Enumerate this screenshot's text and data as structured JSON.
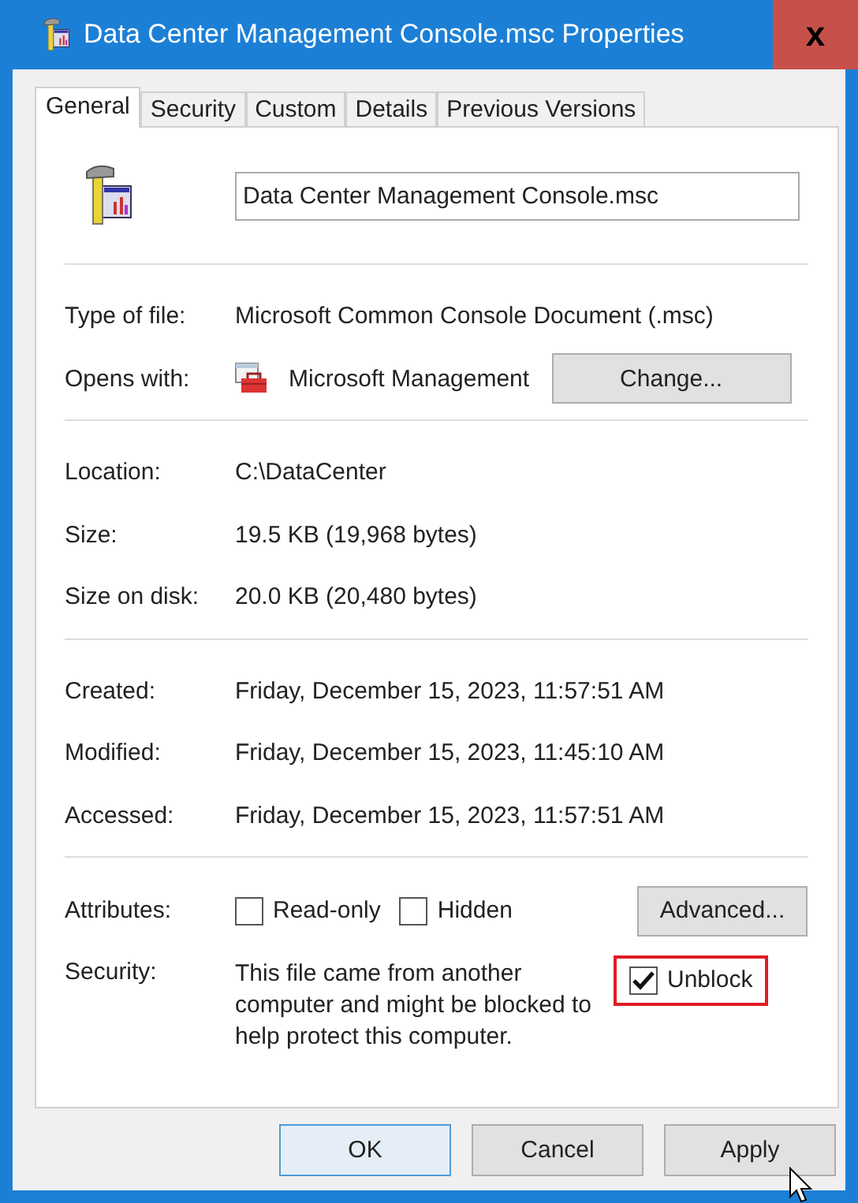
{
  "window": {
    "title": "Data Center Management Console.msc Properties",
    "close": "x"
  },
  "tabs": [
    {
      "label": "General",
      "selected": true
    },
    {
      "label": "Security",
      "selected": false
    },
    {
      "label": "Custom",
      "selected": false
    },
    {
      "label": "Details",
      "selected": false
    },
    {
      "label": "Previous Versions",
      "selected": false
    }
  ],
  "file_name": "Data Center Management Console.msc",
  "groups": [
    [
      {
        "label": "Type of file:",
        "value": "Microsoft Common Console Document (.msc)"
      },
      {
        "label": "Opens with:",
        "value": "Microsoft Management",
        "button": "Change..."
      }
    ],
    [
      {
        "label": "Location:",
        "value": "C:\\DataCenter"
      },
      {
        "label": "Size:",
        "value": "19.5 KB (19,968 bytes)"
      },
      {
        "label": "Size on disk:",
        "value": "20.0 KB (20,480 bytes)"
      }
    ],
    [
      {
        "label": "Created:",
        "value": "Friday, December 15, 2023, 11:57:51 AM"
      },
      {
        "label": "Modified:",
        "value": "Friday, December 15, 2023, 11:45:10 AM"
      },
      {
        "label": "Accessed:",
        "value": "Friday, December 15, 2023, 11:57:51 AM"
      }
    ]
  ],
  "attributes": {
    "label": "Attributes:",
    "checkboxes": [
      {
        "label": "Read-only",
        "checked": false
      },
      {
        "label": "Hidden",
        "checked": false
      }
    ],
    "button": "Advanced..."
  },
  "security": {
    "label": "Security:",
    "text": "This file came from another computer and might be blocked to help protect this computer.",
    "unblock": {
      "label": "Unblock",
      "checked": true,
      "highlighted": true
    }
  },
  "buttons": [
    {
      "label": "OK",
      "default": true
    },
    {
      "label": "Cancel",
      "default": false
    },
    {
      "label": "Apply",
      "default": false
    }
  ]
}
